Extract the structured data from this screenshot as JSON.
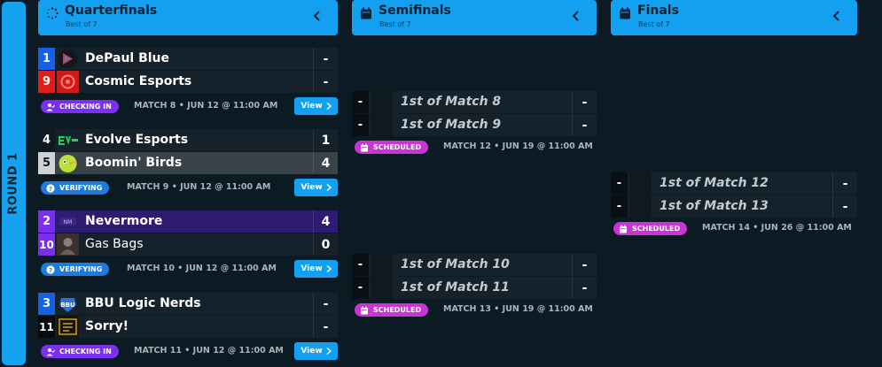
{
  "round": {
    "label": "ROUND 1"
  },
  "columns": [
    {
      "title": "Quarterfinals",
      "subtitle": "Best of 7",
      "icon": "spinner-icon"
    },
    {
      "title": "Semifinals",
      "subtitle": "Best of 7",
      "icon": "calendar-icon"
    },
    {
      "title": "Finals",
      "subtitle": "Best of 7",
      "icon": "calendar-icon"
    }
  ],
  "colors": {
    "accent": "#13a0f0",
    "checking_in": "#7b2ff0",
    "verifying": "#1b7cde",
    "scheduled": "#c935d5"
  },
  "quarterfinals": [
    {
      "teams": [
        {
          "seed": "1",
          "name": "DePaul Blue",
          "score": "-",
          "seed_color": "#1660e8"
        },
        {
          "seed": "9",
          "name": "Cosmic Esports",
          "score": "-",
          "seed_color": "#e01d1d"
        }
      ],
      "status": "CHECKING IN",
      "info": "MATCH 8 • JUN 12 @ 11:00 AM",
      "view_label": "View"
    },
    {
      "teams": [
        {
          "seed": "4",
          "name": "Evolve Esports",
          "score": "1",
          "seed_color": "#0f1a21"
        },
        {
          "seed": "5",
          "name": "Boomin' Birds",
          "score": "4",
          "seed_color": "#cfd3d6"
        }
      ],
      "status": "VERIFYING",
      "info": "MATCH 9 • JUN 12 @ 11:00 AM",
      "view_label": "View"
    },
    {
      "teams": [
        {
          "seed": "2",
          "name": "Nevermore",
          "score": "4",
          "seed_color": "#7a2ff0"
        },
        {
          "seed": "10",
          "name": "Gas Bags",
          "score": "0",
          "seed_color": "#7a2ff0"
        }
      ],
      "status": "VERIFYING",
      "info": "MATCH 10 • JUN 12 @ 11:00 AM",
      "view_label": "View"
    },
    {
      "teams": [
        {
          "seed": "3",
          "name": "BBU Logic Nerds",
          "score": "-",
          "seed_color": "#1660e8"
        },
        {
          "seed": "11",
          "name": "Sorry!",
          "score": "-",
          "seed_color": "#0a0a0a"
        }
      ],
      "status": "CHECKING IN",
      "info": "MATCH 11 • JUN 12 @ 11:00 AM",
      "view_label": "View"
    }
  ],
  "semifinals": [
    {
      "teams": [
        {
          "seed": "-",
          "name": "1st of Match 8",
          "score": "-"
        },
        {
          "seed": "-",
          "name": "1st of Match 9",
          "score": "-"
        }
      ],
      "status": "SCHEDULED",
      "info": "MATCH 12 • JUN 19 @ 11:00 AM"
    },
    {
      "teams": [
        {
          "seed": "-",
          "name": "1st of Match 10",
          "score": "-"
        },
        {
          "seed": "-",
          "name": "1st of Match 11",
          "score": "-"
        }
      ],
      "status": "SCHEDULED",
      "info": "MATCH 13 • JUN 19 @ 11:00 AM"
    }
  ],
  "finals": [
    {
      "teams": [
        {
          "seed": "-",
          "name": "1st of Match 12",
          "score": "-"
        },
        {
          "seed": "-",
          "name": "1st of Match 13",
          "score": "-"
        }
      ],
      "status": "SCHEDULED",
      "info": "MATCH 14 • JUN 26 @ 11:00 AM"
    }
  ]
}
